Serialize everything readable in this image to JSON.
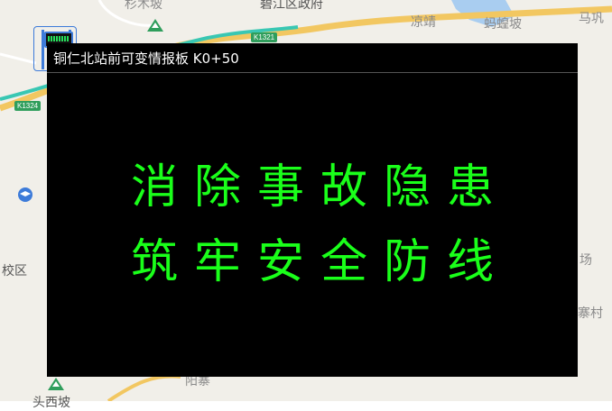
{
  "map": {
    "labels": {
      "top_left_town": "杉木坡",
      "district_gov": "碧江区政府",
      "liangqiao": "凉靖",
      "xiangtang": "蚂蝗坡",
      "makong": "马巩",
      "left_area": "校区",
      "right_chang": "场",
      "right_cun": "寨村",
      "bottom_village": "阳寨",
      "bottom_left_place": "头西坡"
    },
    "road_codes": {
      "k1321": "K1321",
      "k1324": "K1324"
    },
    "colors": {
      "background": "#f1efe9",
      "highway": "#f2c761",
      "rail": "#39c7b3",
      "water": "#a9cdf0"
    }
  },
  "vms": {
    "title": "铜仁北站前可变情报板 K0+50",
    "message_line1": "消除事故隐患",
    "message_line2": "筑牢安全防线",
    "text_color": "#1aff1a",
    "background_color": "#000000"
  },
  "icons": {
    "sign_marker": "variable-message-sign-icon",
    "mountain": "mountain-icon",
    "school": "school-icon"
  }
}
